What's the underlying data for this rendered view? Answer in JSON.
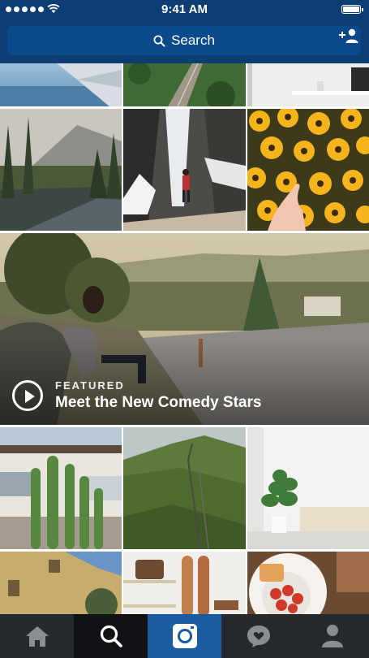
{
  "status": {
    "time": "9:41 AM"
  },
  "search": {
    "placeholder": "Search"
  },
  "featured": {
    "kicker": "FEATURED",
    "title": "Meet the New Comedy Stars"
  },
  "icons": {
    "add_user": "add-user-icon",
    "search": "search-icon",
    "tabs": [
      "home-icon",
      "search-icon",
      "camera-icon",
      "activity-icon",
      "profile-icon"
    ]
  },
  "colors": {
    "nav": "#0c3d73",
    "search_field": "#0a4a8a",
    "tabbar": "#26292e",
    "tab_active": "#1a5ca0"
  }
}
